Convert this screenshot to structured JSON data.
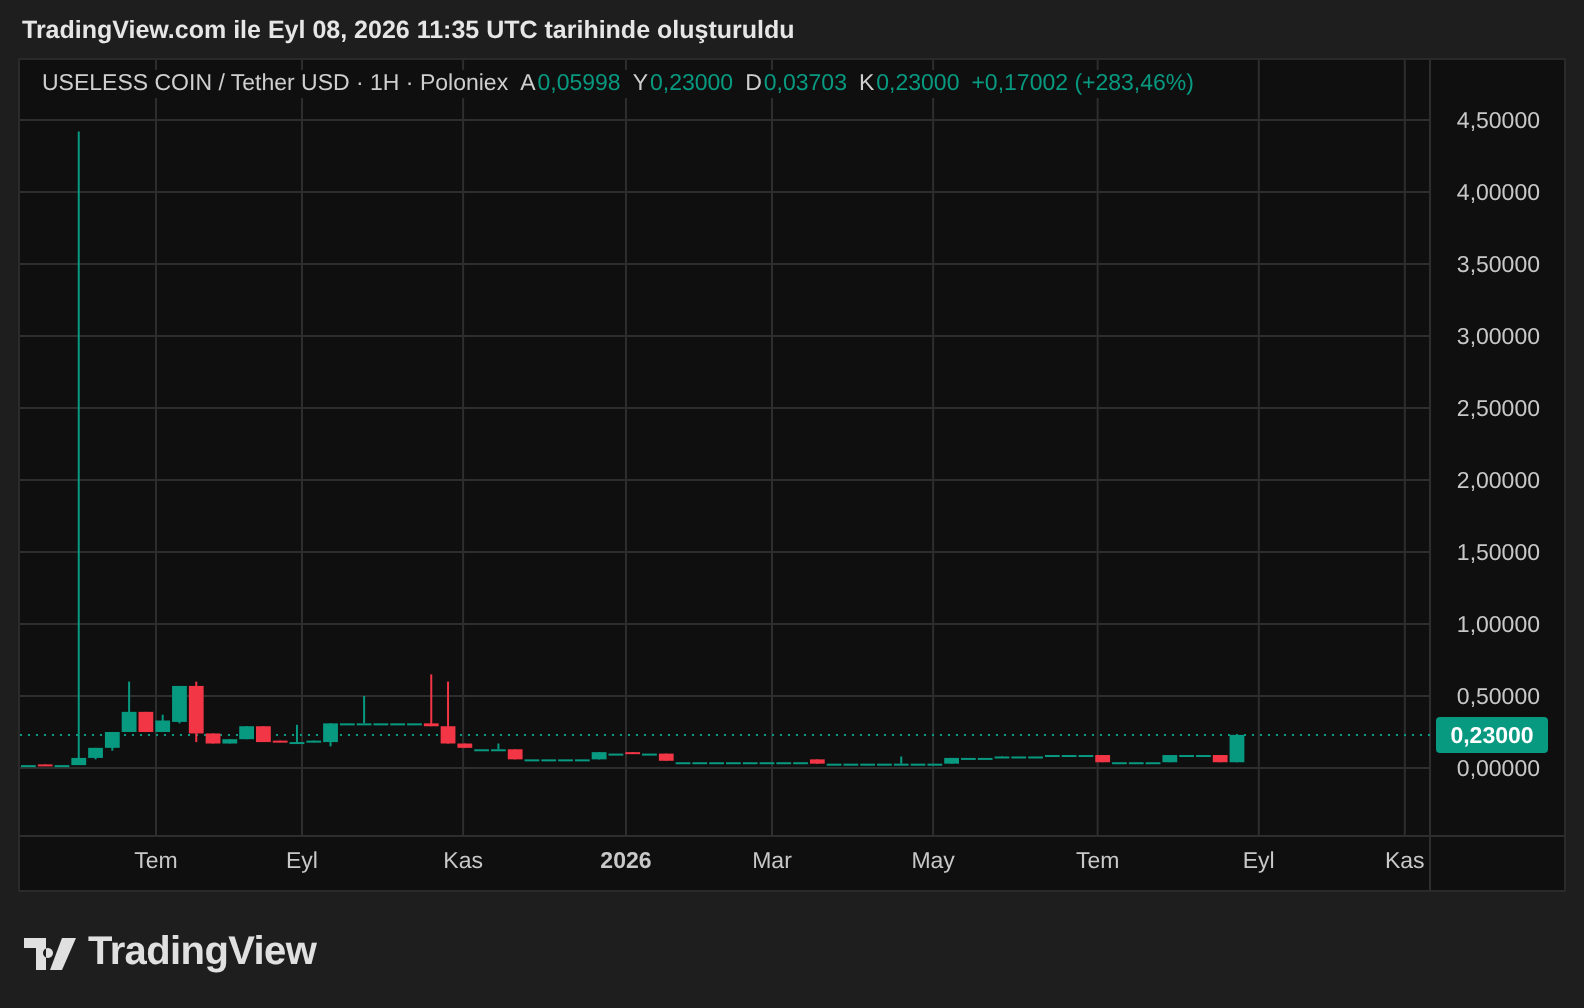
{
  "header": {
    "title": "TradingView.com ile Eyl 08, 2026 11:35 UTC tarihinde oluşturuldu"
  },
  "chart": {
    "legend": {
      "symbol": "USELESS COIN / Tether USD · 1H · Poloniex",
      "ohlc": [
        {
          "label": "A",
          "value": "0,05998"
        },
        {
          "label": "Y",
          "value": "0,23000"
        },
        {
          "label": "D",
          "value": "0,03703"
        },
        {
          "label": "K",
          "value": "0,23000"
        }
      ],
      "change": "+0,17002 (+283,46%)"
    },
    "price_axis": {
      "labels": [
        "4,50000",
        "4,00000",
        "3,50000",
        "3,00000",
        "2,50000",
        "2,00000",
        "1,50000",
        "1,00000",
        "0,50000",
        "0,00000"
      ]
    },
    "time_axis": {
      "labels": [
        {
          "text": "Tem",
          "kind": "month"
        },
        {
          "text": "Eyl",
          "kind": "month"
        },
        {
          "text": "Kas",
          "kind": "month"
        },
        {
          "text": "2026",
          "kind": "year"
        },
        {
          "text": "Mar",
          "kind": "month"
        },
        {
          "text": "May",
          "kind": "month"
        },
        {
          "text": "Tem",
          "kind": "month"
        },
        {
          "text": "Eyl",
          "kind": "month"
        },
        {
          "text": "Kas",
          "kind": "month"
        }
      ]
    },
    "last_price": "0,23000"
  },
  "footer": {
    "logo": "TradingView"
  }
}
